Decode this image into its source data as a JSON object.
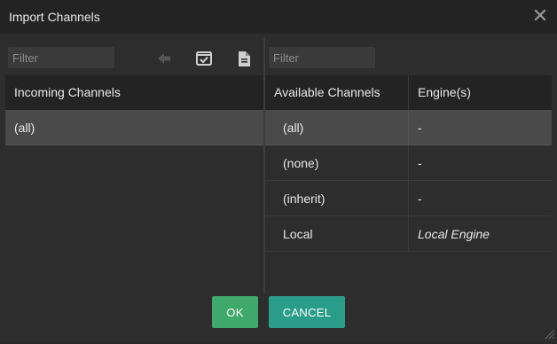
{
  "dialog": {
    "title": "Import Channels"
  },
  "left_pane": {
    "filter_placeholder": "Filter",
    "header": "Incoming Channels",
    "rows": [
      {
        "name": "(all)",
        "selected": true
      }
    ]
  },
  "right_pane": {
    "filter_placeholder": "Filter",
    "headers": {
      "channels": "Available Channels",
      "engines": "Engine(s)"
    },
    "rows": [
      {
        "channel": "(all)",
        "engine": "-",
        "selected": true
      },
      {
        "channel": "(none)",
        "engine": "-"
      },
      {
        "channel": "(inherit)",
        "engine": "-"
      },
      {
        "channel": "Local",
        "engine": "Local Engine",
        "engine_italic": true
      }
    ]
  },
  "toolbar": {
    "icons": [
      "arrow-left-icon",
      "check-square-icon",
      "document-icon"
    ]
  },
  "footer": {
    "ok_label": "OK",
    "cancel_label": "CANCEL"
  },
  "colors": {
    "ok": "#3ea96a",
    "cancel": "#2a9d8a",
    "selected_row": "#4a4a4a",
    "header_bg": "#232323"
  }
}
